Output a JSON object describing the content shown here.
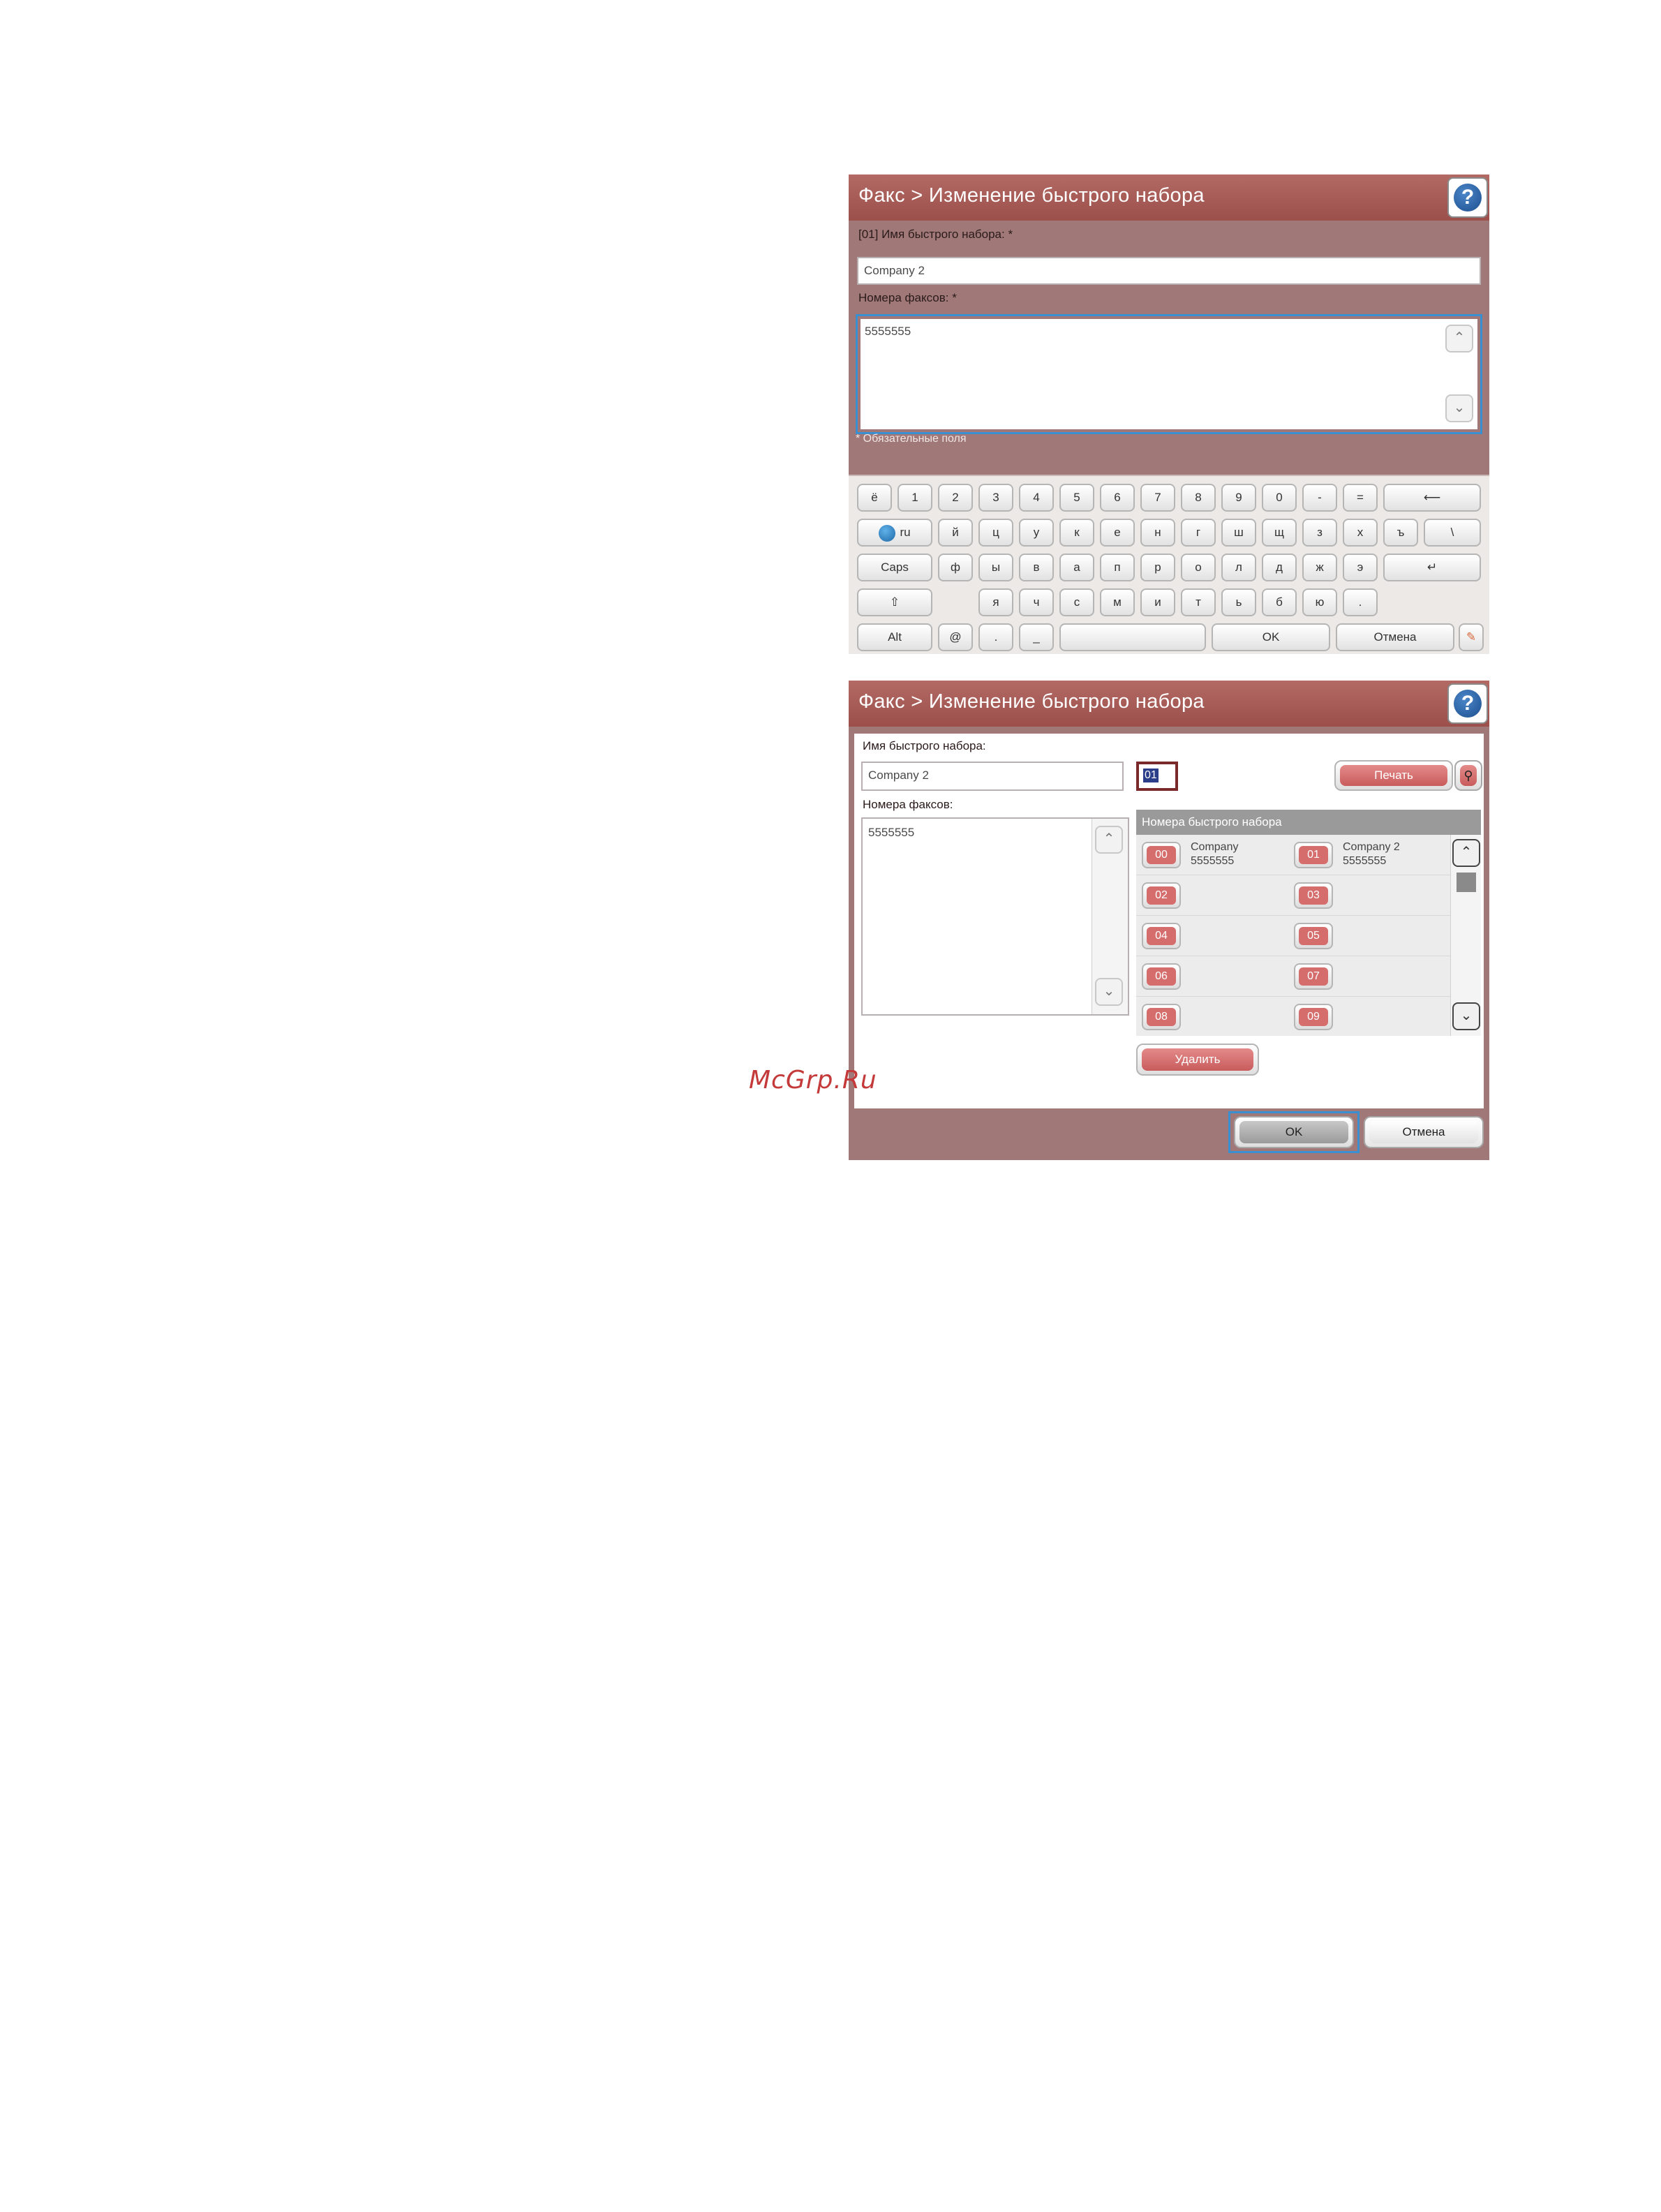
{
  "screen1": {
    "title": "Факс > Изменение быстрого набора",
    "name_label": "[01] Имя быстрого набора: *",
    "name_value": "Company 2",
    "fax_label": "Номера факсов: *",
    "fax_value": "5555555",
    "required_note": "* Обязательные поля",
    "keyboard": {
      "row1": [
        "ё",
        "1",
        "2",
        "3",
        "4",
        "5",
        "6",
        "7",
        "8",
        "9",
        "0",
        "-",
        "="
      ],
      "row2_lang": "ru",
      "row2": [
        "й",
        "ц",
        "у",
        "к",
        "е",
        "н",
        "г",
        "ш",
        "щ",
        "з",
        "х",
        "ъ",
        "\\"
      ],
      "row3_caps": "Caps",
      "row3": [
        "ф",
        "ы",
        "в",
        "а",
        "п",
        "р",
        "о",
        "л",
        "д",
        "ж",
        "э"
      ],
      "row4": [
        "я",
        "ч",
        "с",
        "м",
        "и",
        "т",
        "ь",
        "б",
        "ю",
        "."
      ],
      "row5_alt": "Alt",
      "row5_at": "@",
      "row5_dot": ".",
      "row5_underscore": "_",
      "ok_label": "OK",
      "cancel_label": "Отмена"
    }
  },
  "screen2": {
    "title": "Факс > Изменение быстрого набора",
    "name_label": "Имя быстрого набора:",
    "name_value": "Company 2",
    "speed_index": "01",
    "print_label": "Печать",
    "fax_label": "Номера факсов:",
    "fax_value": "5555555",
    "speed_header": "Номера быстрого набора",
    "speed_dials": [
      {
        "num": "00",
        "name": "Company",
        "fax": "5555555"
      },
      {
        "num": "01",
        "name": "Company 2",
        "fax": "5555555"
      },
      {
        "num": "02",
        "name": "",
        "fax": ""
      },
      {
        "num": "03",
        "name": "",
        "fax": ""
      },
      {
        "num": "04",
        "name": "",
        "fax": ""
      },
      {
        "num": "05",
        "name": "",
        "fax": ""
      },
      {
        "num": "06",
        "name": "",
        "fax": ""
      },
      {
        "num": "07",
        "name": "",
        "fax": ""
      },
      {
        "num": "08",
        "name": "",
        "fax": ""
      },
      {
        "num": "09",
        "name": "",
        "fax": ""
      }
    ],
    "delete_label": "Удалить",
    "ok_label": "OK",
    "cancel_label": "Отмена"
  },
  "watermark": "McGrp.Ru",
  "colors": {
    "titlebar": "#a9574f",
    "panel_bg": "#a07878",
    "accent_red": "#d56d6d",
    "focus_blue": "#3a8fd0"
  }
}
